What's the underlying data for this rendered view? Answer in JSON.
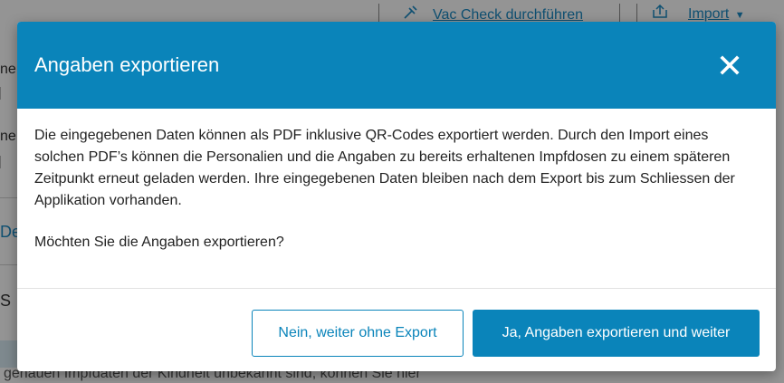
{
  "background": {
    "topbar": {
      "vac_check_label": "Vac Check durchführen",
      "import_label": "Import"
    },
    "bottom_text": "genauen Impfdaten der Kindheit unbekannt sind, können Sie hier"
  },
  "modal": {
    "title": "Angaben exportieren",
    "body_paragraph_1": "Die eingegebenen Daten können als PDF inklusive QR-Codes exportiert werden. Durch den Import eines solchen PDF’s können die Personalien und die Angaben zu bereits erhaltenen Impfdosen zu einem späteren Zeitpunkt erneut geladen werden. Ihre eingegebenen Daten bleiben nach dem Export bis zum Schliessen der Applikation vorhanden.",
    "body_paragraph_2": "Möchten Sie die Angaben exportieren?",
    "secondary_button_label": "Nein, weiter ohne Export",
    "primary_button_label": "Ja, Angaben exportieren und weiter"
  },
  "colors": {
    "accent": "#0a84ba",
    "link": "#1a8ac4"
  }
}
